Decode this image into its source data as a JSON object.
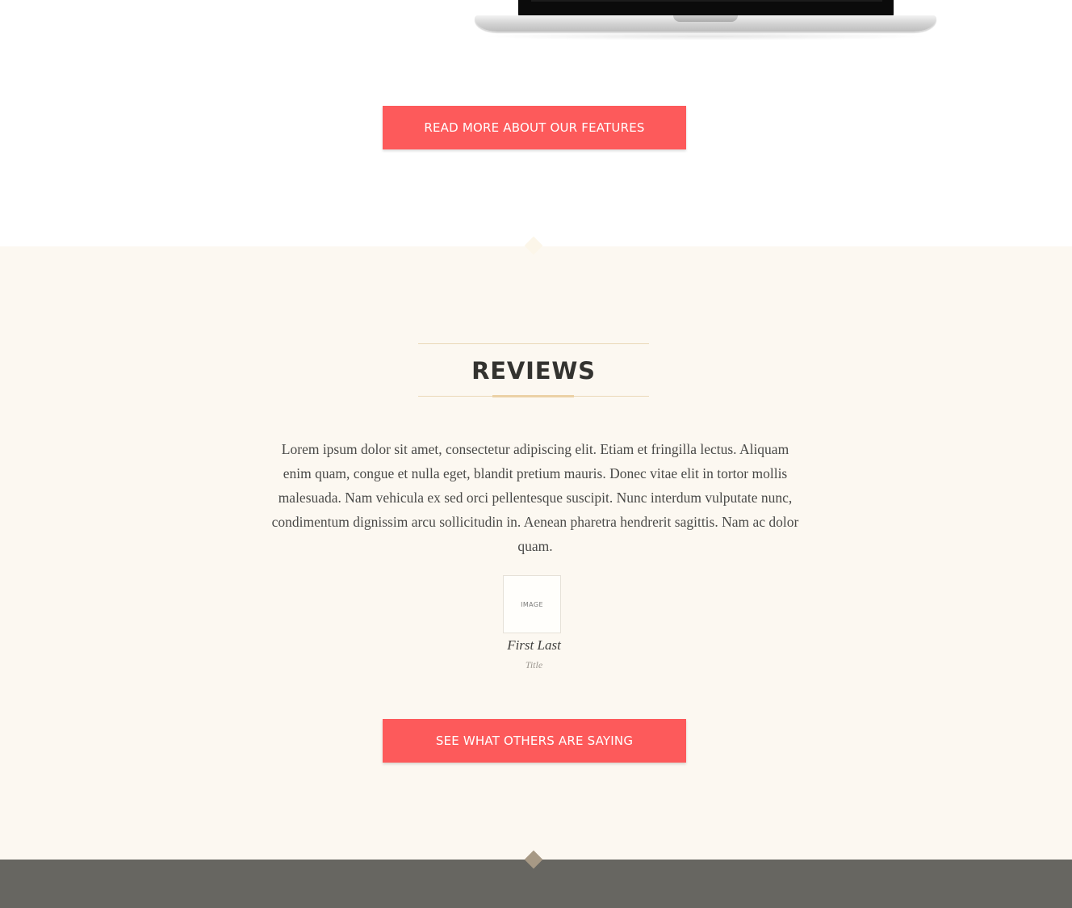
{
  "features": {
    "cta_label": "READ MORE ABOUT OUR FEATURES"
  },
  "reviews": {
    "heading": "REVIEWS",
    "quote": "Lorem ipsum dolor sit amet, consectetur adipiscing elit. Etiam et fringilla lectus. Aliquam enim quam, congue et nulla eget, blandit pretium mauris. Donec vitae elit in tortor mollis malesuada. Nam vehicula ex sed orci pellentesque suscipit. Nunc interdum vulputate nunc, condimentum dignissim arcu sollicitudin in. Aenean pharetra hendrerit sagittis. Nam ac dolor quam.",
    "avatar_placeholder": "IMAGE",
    "reviewer_name": "First Last",
    "reviewer_title": "Title",
    "cta_label": "SEE WHAT OTHERS ARE SAYING"
  },
  "colors": {
    "accent": "#fd5a5b",
    "section_background": "#fcf8f1",
    "footer_background": "#676661",
    "heading_rule": "#ecd1a6",
    "diamond": "#a79985"
  },
  "icons": {
    "hero_image": "laptop-image",
    "section_divider": "diamond-icon"
  }
}
